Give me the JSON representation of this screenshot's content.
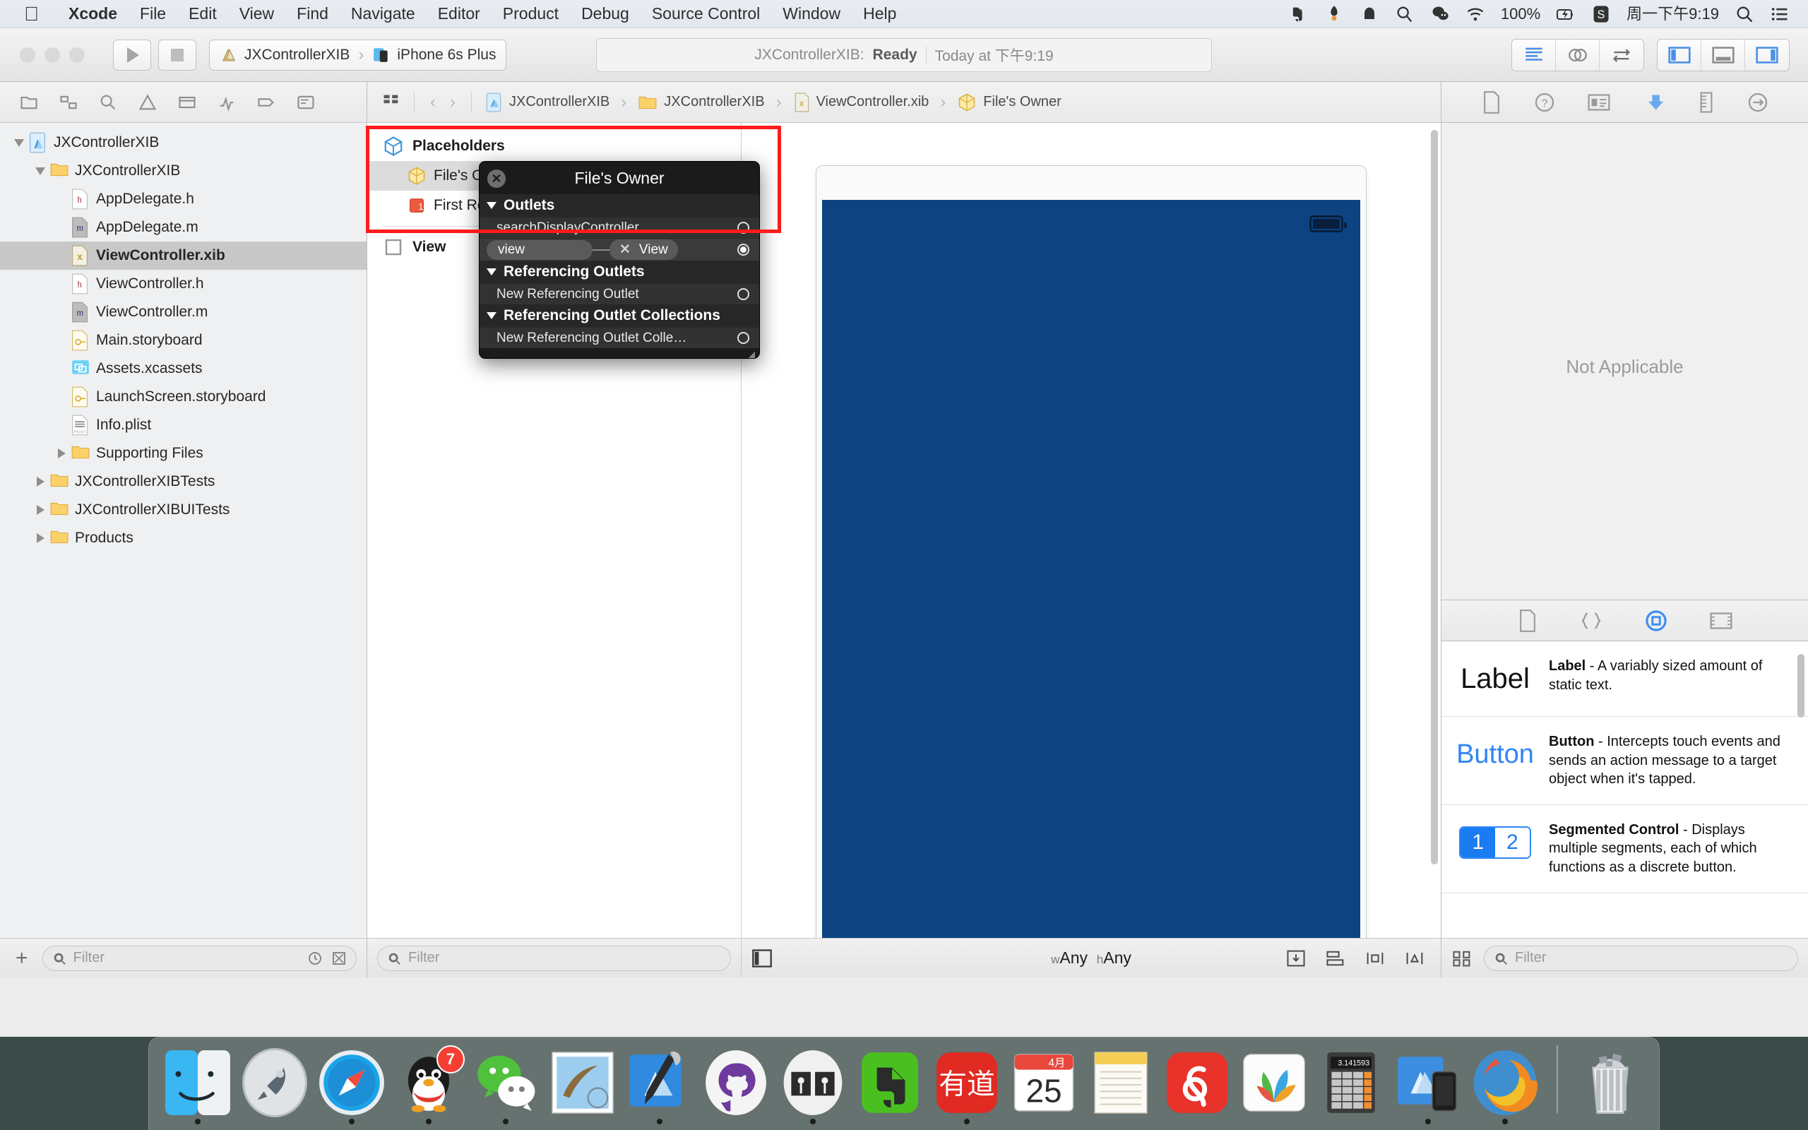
{
  "menubar": {
    "apple_icon": "apple-logo-icon",
    "items": [
      {
        "label": "Xcode",
        "bold": true
      },
      {
        "label": "File",
        "bold": false
      },
      {
        "label": "Edit",
        "bold": false
      },
      {
        "label": "View",
        "bold": false
      },
      {
        "label": "Find",
        "bold": false
      },
      {
        "label": "Navigate",
        "bold": false
      },
      {
        "label": "Editor",
        "bold": false
      },
      {
        "label": "Product",
        "bold": false
      },
      {
        "label": "Debug",
        "bold": false
      },
      {
        "label": "Source Control",
        "bold": false
      },
      {
        "label": "Window",
        "bold": false
      },
      {
        "label": "Help",
        "bold": false
      }
    ],
    "status_items": [
      {
        "name": "evernote-menu-icon",
        "text": ""
      },
      {
        "name": "dropbox-menu-icon",
        "text": ""
      },
      {
        "name": "cloud-menu-icon",
        "text": ""
      },
      {
        "name": "search-magnifier-menu-icon",
        "text": ""
      },
      {
        "name": "wechat-menu-icon",
        "text": ""
      },
      {
        "name": "wifi-menu-icon",
        "text": ""
      }
    ],
    "battery_percent": "100%",
    "battery_icon": "battery-charging-icon",
    "sogou_icon": "sogou-input-icon",
    "clock": "周一下午9:19",
    "spotlight_icon": "spotlight-search-icon",
    "notification_icon": "notification-center-icon"
  },
  "toolbar": {
    "run_button": "run-icon",
    "stop_button": "stop-icon",
    "scheme_name": "JXControllerXIB",
    "destination_name": "iPhone 6s Plus",
    "status_project": "JXControllerXIB:",
    "status_state": "Ready",
    "status_time": "Today at 下午9:19",
    "editor_modes": [
      "standard-editor-icon",
      "assistant-editor-icon",
      "version-editor-icon"
    ],
    "view_toggles": [
      "navigator-toggle-icon",
      "debug-toggle-icon",
      "utilities-toggle-icon"
    ]
  },
  "navigator": {
    "tabs": [
      "project-navigator-icon",
      "symbol-navigator-icon",
      "find-navigator-icon",
      "issue-navigator-icon",
      "test-navigator-icon",
      "debug-navigator-icon",
      "breakpoint-navigator-icon",
      "report-navigator-icon"
    ],
    "tree": [
      {
        "label": "JXControllerXIB",
        "indent": 0,
        "icon": "xcode-project-icon",
        "disclosure": "down",
        "selected": false
      },
      {
        "label": "JXControllerXIB",
        "indent": 1,
        "icon": "folder-icon",
        "disclosure": "down",
        "selected": false
      },
      {
        "label": "AppDelegate.h",
        "indent": 2,
        "icon": "header-file-icon",
        "disclosure": "none",
        "selected": false
      },
      {
        "label": "AppDelegate.m",
        "indent": 2,
        "icon": "objc-file-icon",
        "disclosure": "none",
        "selected": false
      },
      {
        "label": "ViewController.xib",
        "indent": 2,
        "icon": "xib-file-icon",
        "disclosure": "none",
        "selected": true
      },
      {
        "label": "ViewController.h",
        "indent": 2,
        "icon": "header-file-icon",
        "disclosure": "none",
        "selected": false
      },
      {
        "label": "ViewController.m",
        "indent": 2,
        "icon": "objc-file-icon",
        "disclosure": "none",
        "selected": false
      },
      {
        "label": "Main.storyboard",
        "indent": 2,
        "icon": "storyboard-file-icon",
        "disclosure": "none",
        "selected": false
      },
      {
        "label": "Assets.xcassets",
        "indent": 2,
        "icon": "xcassets-icon",
        "disclosure": "none",
        "selected": false
      },
      {
        "label": "LaunchScreen.storyboard",
        "indent": 2,
        "icon": "storyboard-file-icon",
        "disclosure": "none",
        "selected": false
      },
      {
        "label": "Info.plist",
        "indent": 2,
        "icon": "plist-file-icon",
        "disclosure": "none",
        "selected": false
      },
      {
        "label": "Supporting Files",
        "indent": 2,
        "icon": "folder-icon",
        "disclosure": "right",
        "selected": false
      },
      {
        "label": "JXControllerXIBTests",
        "indent": 1,
        "icon": "folder-icon",
        "disclosure": "right",
        "selected": false
      },
      {
        "label": "JXControllerXIBUITests",
        "indent": 1,
        "icon": "folder-icon",
        "disclosure": "right",
        "selected": false
      },
      {
        "label": "Products",
        "indent": 1,
        "icon": "folder-icon",
        "disclosure": "right",
        "selected": false
      }
    ],
    "add_button": "+",
    "filter_placeholder": "Filter",
    "filter_value": "",
    "filter_trailing_icons": [
      "recent-files-filter-icon",
      "source-control-filter-icon"
    ]
  },
  "jumpbar": {
    "related_items_icon": "related-items-icon",
    "back_icon": "back-chevron-icon",
    "forward_icon": "forward-chevron-icon",
    "crumbs": [
      {
        "label": "JXControllerXIB",
        "icon": "xcode-project-icon"
      },
      {
        "label": "JXControllerXIB",
        "icon": "folder-icon"
      },
      {
        "label": "ViewController.xib",
        "icon": "xib-file-icon"
      },
      {
        "label": "File's Owner",
        "icon": "files-owner-icon"
      }
    ]
  },
  "outline": {
    "header": {
      "label": "Placeholders",
      "icon": "placeholders-cube-icon"
    },
    "items": [
      {
        "label": "File's Owner",
        "icon": "files-owner-icon",
        "selected": true
      },
      {
        "label": "First Responder",
        "icon": "first-responder-icon",
        "selected": false
      }
    ],
    "objects": [
      {
        "label": "View",
        "icon": "view-square-icon",
        "selected": false
      }
    ],
    "filter_placeholder": "Filter",
    "filter_value": ""
  },
  "canvas": {
    "size_class": {
      "w_prefix": "w",
      "w_value": "Any",
      "h_prefix": "h",
      "h_value": "Any"
    },
    "view_color": "#0d4381",
    "document_outline_toggle": "document-outline-toggle-icon",
    "autolayout_icons": [
      "update-frames-icon",
      "align-icon",
      "pin-icon",
      "resolve-issues-icon"
    ]
  },
  "hud": {
    "title": "File's Owner",
    "close_icon": "hud-close-icon",
    "sections": [
      {
        "title": "Outlets",
        "rows": [
          {
            "type": "empty",
            "label": "searchDisplayController",
            "connected": false
          },
          {
            "type": "connected",
            "label": "view",
            "target": "View",
            "connected": true
          }
        ]
      },
      {
        "title": "Referencing Outlets",
        "rows": [
          {
            "type": "empty",
            "label": "New Referencing Outlet",
            "connected": false
          }
        ]
      },
      {
        "title": "Referencing Outlet Collections",
        "rows": [
          {
            "type": "empty",
            "label": "New Referencing Outlet Colle…",
            "connected": false
          }
        ]
      }
    ],
    "resize_grip": "resize-grip-icon"
  },
  "annotation": {
    "highlight_color": "#ff1b1b"
  },
  "utilities": {
    "inspector_tabs": [
      {
        "name": "file-inspector-icon",
        "selected": false
      },
      {
        "name": "quick-help-inspector-icon",
        "selected": false
      },
      {
        "name": "identity-inspector-icon",
        "selected": false
      },
      {
        "name": "attributes-inspector-icon",
        "selected": true
      },
      {
        "name": "size-inspector-icon",
        "selected": false
      },
      {
        "name": "connections-inspector-icon",
        "selected": false
      }
    ],
    "inspector_empty_text": "Not Applicable",
    "library_tabs": [
      {
        "name": "file-template-library-icon",
        "selected": false
      },
      {
        "name": "code-snippet-library-icon",
        "selected": false
      },
      {
        "name": "object-library-icon",
        "selected": true
      },
      {
        "name": "media-library-icon",
        "selected": false
      }
    ],
    "library_items": [
      {
        "preview": "Label",
        "preview_style": "label",
        "title": "Label",
        "desc": " - A variably sized amount of static text."
      },
      {
        "preview": "Button",
        "preview_style": "button",
        "title": "Button",
        "desc": " - Intercepts touch events and sends an action message to a target object when it's tapped."
      },
      {
        "preview": "1|2",
        "preview_style": "segmented",
        "seg_a": "1",
        "seg_b": "2",
        "title": "Segmented Control",
        "desc": " - Displays multiple segments, each of which functions as a discrete button."
      }
    ],
    "library_view_icon": "library-grid-view-icon",
    "library_filter_placeholder": "Filter",
    "library_filter_value": ""
  },
  "dock": {
    "items": [
      {
        "name": "finder",
        "color": "#3dadf2",
        "running": true,
        "badge": ""
      },
      {
        "name": "launchpad",
        "color": "#b6bcc2",
        "running": false,
        "badge": ""
      },
      {
        "name": "safari",
        "color": "#1a9ae8",
        "running": true,
        "badge": ""
      },
      {
        "name": "qq",
        "color": "#ffffff",
        "running": true,
        "badge": "7"
      },
      {
        "name": "wechat",
        "color": "#5ecc47",
        "running": true,
        "badge": ""
      },
      {
        "name": "mail",
        "color": "#8fc7ea",
        "running": false,
        "badge": ""
      },
      {
        "name": "xcode",
        "color": "#2f7fd8",
        "running": true,
        "badge": ""
      },
      {
        "name": "github-desktop",
        "color": "#f0f0f0",
        "running": false,
        "badge": ""
      },
      {
        "name": "ibooks",
        "color": "#f2f2f2",
        "running": true,
        "badge": ""
      },
      {
        "name": "evernote",
        "color": "#4ac020",
        "running": false,
        "badge": ""
      },
      {
        "name": "youdao-dictionary",
        "color": "#e02a22",
        "running": true,
        "badge": ""
      },
      {
        "name": "calendar",
        "color": "#ffffff",
        "running": false,
        "badge": "",
        "cal_month": "4月",
        "cal_day": "25"
      },
      {
        "name": "notes",
        "color": "#f7f3e8",
        "running": false,
        "badge": ""
      },
      {
        "name": "netease-music",
        "color": "#e8322a",
        "running": false,
        "badge": ""
      },
      {
        "name": "mindnode",
        "color": "#fbfbfb",
        "running": false,
        "badge": ""
      },
      {
        "name": "calculator",
        "color": "#3a3a3a",
        "running": false,
        "badge": "",
        "calc_display": "3.141593"
      },
      {
        "name": "simulator",
        "color": "#3c8ee0",
        "running": true,
        "badge": ""
      },
      {
        "name": "firefox",
        "color": "#f27a1a",
        "running": true,
        "badge": ""
      }
    ],
    "trash": {
      "name": "trash",
      "label": "Trash"
    }
  }
}
